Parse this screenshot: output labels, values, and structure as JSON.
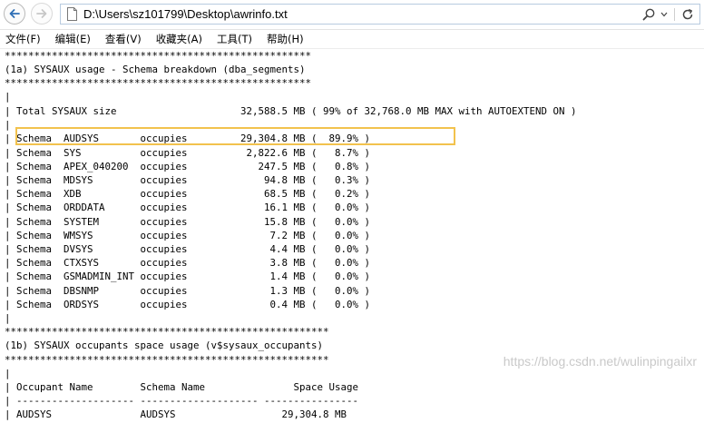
{
  "address_bar": {
    "url": "D:\\Users\\sz101799\\Desktop\\awrinfo.txt"
  },
  "menu": [
    "文件(F)",
    "编辑(E)",
    "查看(V)",
    "收藏夹(A)",
    "工具(T)",
    "帮助(H)"
  ],
  "lines": [
    "****************************************************",
    "(1a) SYSAUX usage - Schema breakdown (dba_segments)",
    "****************************************************",
    "|",
    "| Total SYSAUX size                     32,588.5 MB ( 99% of 32,768.0 MB MAX with AUTOEXTEND ON )",
    "|",
    "| Schema  AUDSYS       occupies         29,304.8 MB (  89.9% )",
    "| Schema  SYS          occupies          2,822.6 MB (   8.7% )",
    "| Schema  APEX_040200  occupies            247.5 MB (   0.8% )",
    "| Schema  MDSYS        occupies             94.8 MB (   0.3% )",
    "| Schema  XDB          occupies             68.5 MB (   0.2% )",
    "| Schema  ORDDATA      occupies             16.1 MB (   0.0% )",
    "| Schema  SYSTEM       occupies             15.8 MB (   0.0% )",
    "| Schema  WMSYS        occupies              7.2 MB (   0.0% )",
    "| Schema  DVSYS        occupies              4.4 MB (   0.0% )",
    "| Schema  CTXSYS       occupies              3.8 MB (   0.0% )",
    "| Schema  GSMADMIN_INT occupies              1.4 MB (   0.0% )",
    "| Schema  DBSNMP       occupies              1.3 MB (   0.0% )",
    "| Schema  ORDSYS       occupies              0.4 MB (   0.0% )",
    "|",
    "*******************************************************",
    "(1b) SYSAUX occupants space usage (v$sysaux_occupants)",
    "*******************************************************",
    "|",
    "| Occupant Name        Schema Name               Space Usage",
    "| -------------------- -------------------- ----------------",
    "| AUDSYS               AUDSYS                  29,304.8 MB"
  ],
  "watermark": "https://blog.csdn.net/wulinpingailxr"
}
